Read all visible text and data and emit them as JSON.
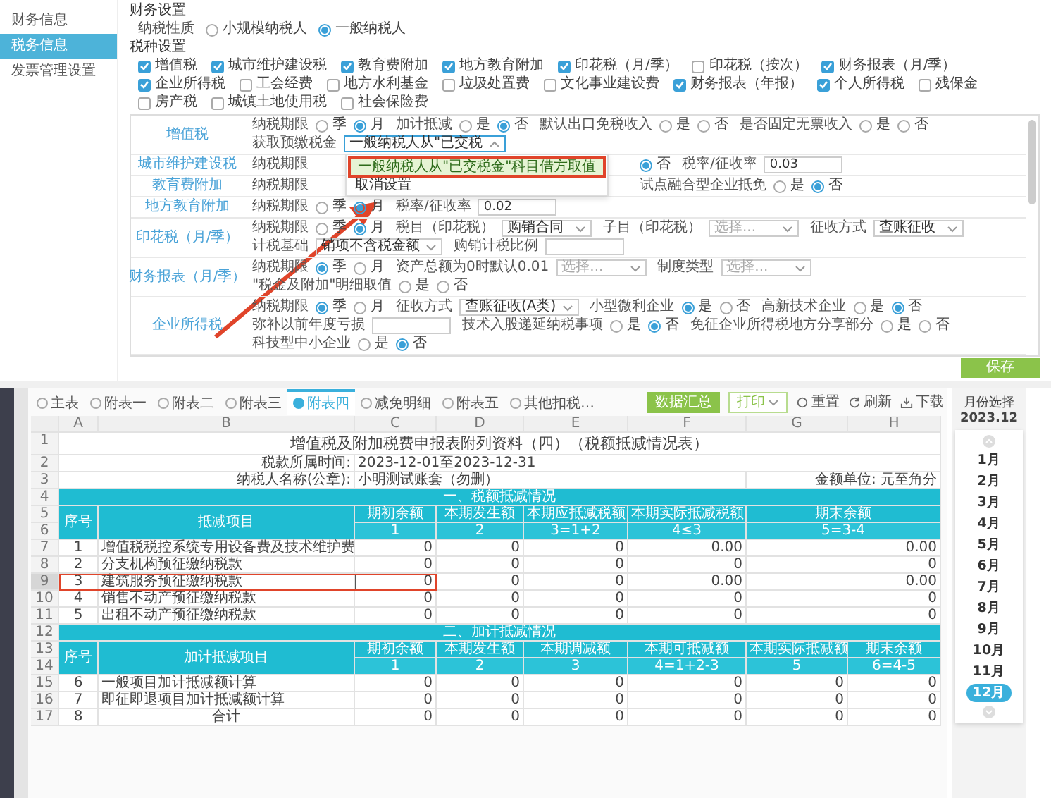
{
  "sidebar": {
    "items": [
      {
        "label": "财务信息",
        "selected": false
      },
      {
        "label": "税务信息",
        "selected": true
      },
      {
        "label": "发票管理设置",
        "selected": false
      }
    ]
  },
  "finance_settings": {
    "title": "财务设置",
    "taxpayer_type": {
      "label": "纳税性质",
      "options": [
        {
          "label": "小规模纳税人",
          "selected": false
        },
        {
          "label": "一般纳税人",
          "selected": true
        }
      ]
    }
  },
  "tax_types": {
    "title": "税种设置",
    "items": [
      {
        "label": "增值税",
        "checked": true
      },
      {
        "label": "城市维护建设税",
        "checked": true
      },
      {
        "label": "教育费附加",
        "checked": true
      },
      {
        "label": "地方教育附加",
        "checked": true
      },
      {
        "label": "印花税（月/季）",
        "checked": true
      },
      {
        "label": "印花税（按次）",
        "checked": false
      },
      {
        "label": "财务报表（月/季）",
        "checked": true
      },
      {
        "label": "企业所得税",
        "checked": true
      },
      {
        "label": "工会经费",
        "checked": false
      },
      {
        "label": "地方水利基金",
        "checked": false
      },
      {
        "label": "垃圾处置费",
        "checked": false
      },
      {
        "label": "文化事业建设费",
        "checked": false
      },
      {
        "label": "财务报表（年报）",
        "checked": true
      },
      {
        "label": "个人所得税",
        "checked": true
      },
      {
        "label": "残保金",
        "checked": false
      },
      {
        "label": "房产税",
        "checked": false
      },
      {
        "label": "城镇土地使用税",
        "checked": false
      },
      {
        "label": "社会保险费",
        "checked": false
      }
    ]
  },
  "tax_settings": [
    {
      "name": "增值税",
      "lines": [
        [
          {
            "kind": "radio",
            "label": "纳税期限",
            "options": [
              {
                "label": "季",
                "selected": false
              },
              {
                "label": "月",
                "selected": true
              }
            ]
          },
          {
            "kind": "radio",
            "label": "加计抵减",
            "options": [
              {
                "label": "是",
                "selected": false
              },
              {
                "label": "否",
                "selected": true
              }
            ]
          },
          {
            "kind": "radio",
            "label": "默认出口免税收入",
            "options": [
              {
                "label": "是",
                "selected": false
              },
              {
                "label": "否",
                "selected": false
              }
            ]
          },
          {
            "kind": "radio",
            "label": "是否固定无票收入",
            "options": [
              {
                "label": "是",
                "selected": false
              },
              {
                "label": "否",
                "selected": false
              }
            ]
          }
        ],
        [
          {
            "kind": "dropdown",
            "label": "获取预缴税金",
            "value": "一般纳税人从\"已交税",
            "open": true,
            "options": [
              {
                "label": "一般纳税人从\"已交税金\"科目借方取值",
                "selected": true
              },
              {
                "label": "取消设置",
                "selected": false
              }
            ]
          }
        ]
      ]
    },
    {
      "name": "城市维护建设税",
      "lines": [
        [
          {
            "kind": "label",
            "label": "纳税期限"
          },
          {
            "kind": "radio",
            "options": [
              {
                "label": "否",
                "selected": true
              }
            ]
          },
          {
            "kind": "input",
            "label": "税率/征收率",
            "value": "0.03"
          }
        ]
      ]
    },
    {
      "name": "教育费附加",
      "lines": [
        [
          {
            "kind": "label",
            "label": "纳税期限"
          },
          {
            "kind": "radio",
            "label": "试点融合型企业抵免",
            "options": [
              {
                "label": "是",
                "selected": false
              },
              {
                "label": "否",
                "selected": true
              }
            ]
          }
        ]
      ]
    },
    {
      "name": "地方教育附加",
      "lines": [
        [
          {
            "kind": "radio",
            "label": "纳税期限",
            "options": [
              {
                "label": "季",
                "selected": false
              },
              {
                "label": "月",
                "selected": true
              }
            ]
          },
          {
            "kind": "input",
            "label": "税率/征收率",
            "value": "0.02"
          }
        ]
      ]
    },
    {
      "name": "印花税（月/季）",
      "lines": [
        [
          {
            "kind": "radio",
            "label": "纳税期限",
            "options": [
              {
                "label": "季",
                "selected": false
              },
              {
                "label": "月",
                "selected": true
              }
            ]
          },
          {
            "kind": "select",
            "label": "税目（印花税）",
            "value": "购销合同"
          },
          {
            "kind": "select",
            "label": "子目（印花税）",
            "placeholder": "选择..."
          },
          {
            "kind": "select",
            "label": "征收方式",
            "value": "查账征收"
          }
        ],
        [
          {
            "kind": "select",
            "label": "计税基础",
            "value": "销项不含税金额"
          },
          {
            "kind": "input",
            "label": "购销计税比例"
          }
        ]
      ]
    },
    {
      "name": "财务报表（月/季）",
      "lines": [
        [
          {
            "kind": "radio",
            "label": "纳税期限",
            "options": [
              {
                "label": "季",
                "selected": true
              },
              {
                "label": "月",
                "selected": false
              }
            ]
          },
          {
            "kind": "select",
            "label": "资产总额为0时默认0.01",
            "placeholder": "选择..."
          },
          {
            "kind": "select",
            "label": "制度类型",
            "placeholder": "选择..."
          },
          {
            "kind": "radio",
            "label": "\"税金及附加\"明细取值",
            "options": [
              {
                "label": "是",
                "selected": false
              },
              {
                "label": "否",
                "selected": false
              }
            ]
          }
        ]
      ]
    },
    {
      "name": "企业所得税",
      "lines": [
        [
          {
            "kind": "radio",
            "label": "纳税期限",
            "options": [
              {
                "label": "季",
                "selected": true
              },
              {
                "label": "月",
                "selected": false
              }
            ]
          },
          {
            "kind": "select",
            "label": "征收方式",
            "value": "查账征收(A类)"
          },
          {
            "kind": "radio",
            "label": "小型微利企业",
            "options": [
              {
                "label": "是",
                "selected": true
              },
              {
                "label": "否",
                "selected": false
              }
            ]
          },
          {
            "kind": "radio",
            "label": "高新技术企业",
            "options": [
              {
                "label": "是",
                "selected": false
              },
              {
                "label": "否",
                "selected": true
              }
            ]
          }
        ],
        [
          {
            "kind": "input",
            "label": "弥补以前年度亏损"
          },
          {
            "kind": "radio",
            "label": "技术入股递延纳税事项",
            "options": [
              {
                "label": "是",
                "selected": false
              },
              {
                "label": "否",
                "selected": true
              }
            ]
          },
          {
            "kind": "radio",
            "label": "免征企业所得税地方分享部分",
            "options": [
              {
                "label": "是",
                "selected": false
              },
              {
                "label": "否",
                "selected": false
              }
            ]
          },
          {
            "kind": "radio",
            "label": "科技型中小企业",
            "options": [
              {
                "label": "是",
                "selected": false
              },
              {
                "label": "否",
                "selected": true
              }
            ]
          }
        ]
      ]
    }
  ],
  "save_button": "保存",
  "sheet_tabs": [
    {
      "label": "主表",
      "selected": false
    },
    {
      "label": "附表一",
      "selected": false
    },
    {
      "label": "附表二",
      "selected": false
    },
    {
      "label": "附表三",
      "selected": false
    },
    {
      "label": "附表四",
      "selected": true
    },
    {
      "label": "减免明细",
      "selected": false
    },
    {
      "label": "附表五",
      "selected": false
    },
    {
      "label": "其他扣税…",
      "selected": false
    }
  ],
  "toolbar": {
    "summary_button": "数据汇总",
    "menu_button": "打印",
    "reset": "重置",
    "refresh": "刷新",
    "download": "下载"
  },
  "sheet": {
    "column_letters": [
      "A",
      "B",
      "C",
      "D",
      "E",
      "F",
      "G",
      "H"
    ],
    "row_numbers": [
      "1",
      "2",
      "3",
      "4",
      "5",
      "6",
      "7",
      "8",
      "9",
      "10",
      "11",
      "12",
      "13",
      "14",
      "15",
      "16",
      "17"
    ],
    "title": "增值税及附加税费申报表附列资料（四）（税额抵减情况表）",
    "period_label": "税款所属时间:",
    "period": "2023-12-01至2023-12-31",
    "taxpayer_label": "纳税人名称(公章):",
    "taxpayer": "小明测试账套（勿删）",
    "unit": "金额单位: 元至角分",
    "sections": [
      {
        "title": "一、税额抵减情况",
        "columns": [
          {
            "label": "序号"
          },
          {
            "label": "抵减项目"
          },
          {
            "label": "期初余额",
            "code": "1"
          },
          {
            "label": "本期发生额",
            "code": "2"
          },
          {
            "label": "本期应抵减税额",
            "code": "3=1+2"
          },
          {
            "label": "本期实际抵减税额",
            "code": "4≤3"
          },
          {
            "label": "期末余额",
            "code": "5=3-4"
          }
        ],
        "rows": [
          {
            "cells": [
              "1",
              "增值税税控系统专用设备费及技术维护费",
              "0",
              "0",
              "0",
              "0.00",
              "0.00"
            ],
            "selected": false
          },
          {
            "cells": [
              "2",
              "分支机构预征缴纳税款",
              "0",
              "0",
              "0",
              "0",
              "0"
            ],
            "selected": false
          },
          {
            "cells": [
              "3",
              "建筑服务预征缴纳税款",
              "0",
              "0",
              "0",
              "0.00",
              "0.00"
            ],
            "selected": true
          },
          {
            "cells": [
              "4",
              "销售不动产预征缴纳税款",
              "0",
              "0",
              "0",
              "0",
              "0"
            ],
            "selected": false
          },
          {
            "cells": [
              "5",
              "出租不动产预征缴纳税款",
              "0",
              "0",
              "0",
              "0",
              "0"
            ],
            "selected": false
          }
        ]
      },
      {
        "title": "二、加计抵减情况",
        "columns": [
          {
            "label": "序号"
          },
          {
            "label": "加计抵减项目"
          },
          {
            "label": "期初余额",
            "code": "1"
          },
          {
            "label": "本期发生额",
            "code": "2"
          },
          {
            "label": "本期调减额",
            "code": "3"
          },
          {
            "label": "本期可抵减额",
            "code": "4=1+2-3"
          },
          {
            "label": "本期实际抵减额",
            "code": "5"
          },
          {
            "label": "期末余额",
            "code": "6=4-5"
          }
        ],
        "rows": [
          {
            "cells": [
              "6",
              "一般项目加计抵减额计算",
              "0",
              "0",
              "0",
              "0",
              "0",
              "0"
            ],
            "selected": false
          },
          {
            "cells": [
              "7",
              "即征即退项目加计抵减额计算",
              "0",
              "0",
              "0",
              "0",
              "0",
              "0"
            ],
            "selected": false
          },
          {
            "cells": [
              "8",
              "合计",
              "0",
              "0",
              "0",
              "0",
              "0",
              "0"
            ],
            "selected": false,
            "kind": "total"
          }
        ]
      }
    ]
  },
  "month_panel": {
    "title": "月份选择",
    "year_month": "2023.12",
    "months": [
      {
        "label": "1月",
        "selected": false
      },
      {
        "label": "2月",
        "selected": false
      },
      {
        "label": "3月",
        "selected": false
      },
      {
        "label": "4月",
        "selected": false
      },
      {
        "label": "5月",
        "selected": false
      },
      {
        "label": "6月",
        "selected": false
      },
      {
        "label": "7月",
        "selected": false
      },
      {
        "label": "8月",
        "selected": false
      },
      {
        "label": "9月",
        "selected": false
      },
      {
        "label": "10月",
        "selected": false
      },
      {
        "label": "11月",
        "selected": false
      },
      {
        "label": "12月",
        "selected": true
      }
    ]
  }
}
